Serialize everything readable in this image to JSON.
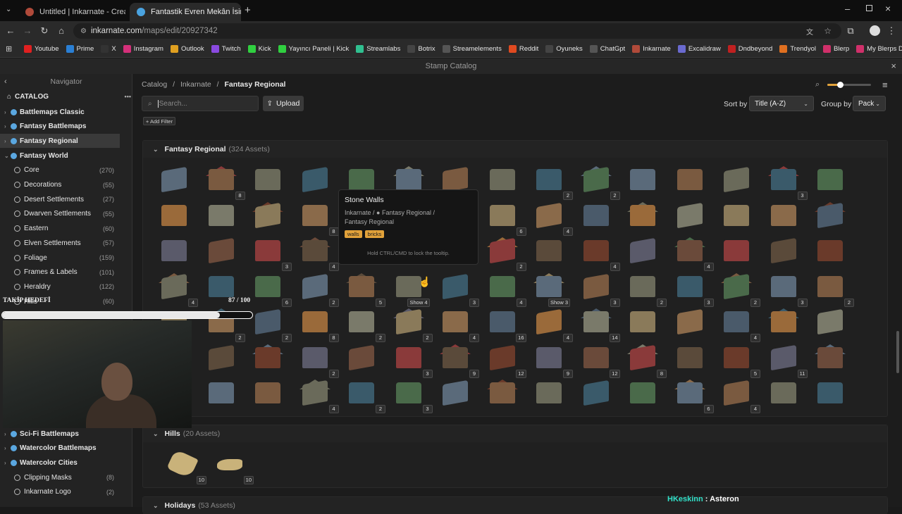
{
  "browser": {
    "tabs": [
      {
        "title": "Untitled | Inkarnate - Create Fa",
        "favicon_color": "#b04a3a"
      },
      {
        "title": "Fantastik Evren Mekân İsimleri",
        "favicon_color": "#4aa3e0"
      }
    ],
    "url_host": "inkarnate.com",
    "url_path": "/maps/edit/20927342",
    "bookmarks": [
      {
        "label": "Youtube",
        "color": "#e02020"
      },
      {
        "label": "Prime",
        "color": "#2a7fd4"
      },
      {
        "label": "X",
        "color": "#333333"
      },
      {
        "label": "Instagram",
        "color": "#d4307a"
      },
      {
        "label": "Outlook",
        "color": "#e0a020"
      },
      {
        "label": "Twitch",
        "color": "#8a4ae0"
      },
      {
        "label": "Kick",
        "color": "#30d040"
      },
      {
        "label": "Yayıncı Paneli | Kick",
        "color": "#30d040"
      },
      {
        "label": "Streamlabs",
        "color": "#30c090"
      },
      {
        "label": "Botrix",
        "color": "#444444"
      },
      {
        "label": "Streamelements",
        "color": "#555555"
      },
      {
        "label": "Reddit",
        "color": "#e04a20"
      },
      {
        "label": "Oyuneks",
        "color": "#444444"
      },
      {
        "label": "ChatGpt",
        "color": "#555555"
      },
      {
        "label": "Inkarnate",
        "color": "#b04a3a"
      },
      {
        "label": "Excalidraw",
        "color": "#6a6ad0"
      },
      {
        "label": "Dndbeyond",
        "color": "#c02020"
      },
      {
        "label": "Trendyol",
        "color": "#e07020"
      },
      {
        "label": "Blerp",
        "color": "#d0306a"
      },
      {
        "label": "My Blerps Dashboard",
        "color": "#d0306a"
      }
    ]
  },
  "app": {
    "title": "Stamp Catalog"
  },
  "navigator": {
    "title": "Navigator",
    "catalog_label": "CATALOG",
    "more": "•••",
    "items": [
      {
        "label": "Battlemaps Classic",
        "type": "pack"
      },
      {
        "label": "Fantasy Battlemaps",
        "type": "pack"
      },
      {
        "label": "Fantasy Regional",
        "type": "pack",
        "selected": true
      },
      {
        "label": "Fantasy World",
        "type": "pack",
        "expanded": true
      },
      {
        "label": "Core",
        "count": "(270)",
        "type": "sub"
      },
      {
        "label": "Decorations",
        "count": "(55)",
        "type": "sub"
      },
      {
        "label": "Desert Settlements",
        "count": "(27)",
        "type": "sub"
      },
      {
        "label": "Dwarven Settlements",
        "count": "(55)",
        "type": "sub"
      },
      {
        "label": "Eastern",
        "count": "(60)",
        "type": "sub"
      },
      {
        "label": "Elven Settlements",
        "count": "(57)",
        "type": "sub"
      },
      {
        "label": "Foliage",
        "count": "(159)",
        "type": "sub"
      },
      {
        "label": "Frames & Labels",
        "count": "(101)",
        "type": "sub"
      },
      {
        "label": "Heraldry",
        "count": "(122)",
        "type": "sub"
      },
      {
        "label": "Hills",
        "count": "(60)",
        "type": "sub"
      }
    ],
    "bottom_items": [
      {
        "label": "Sci-Fi Battlemaps",
        "type": "pack"
      },
      {
        "label": "Watercolor Battlemaps",
        "type": "pack"
      },
      {
        "label": "Watercolor Cities",
        "type": "pack"
      },
      {
        "label": "Clipping Masks",
        "count": "(8)",
        "type": "sub"
      },
      {
        "label": "Inkarnate Logo",
        "count": "(2)",
        "type": "sub"
      }
    ]
  },
  "main": {
    "breadcrumb": [
      "Catalog",
      "Inkarnate",
      "Fantasy Regional"
    ],
    "search_placeholder": "Search...",
    "upload_label": "Upload",
    "add_filter": "+ Add Filter",
    "sort_label": "Sort by",
    "sort_value": "Title (A-Z)",
    "group_label": "Group by",
    "group_value": "Pack",
    "groups": [
      {
        "name": "Fantasy Regional",
        "count": "(324 Assets)"
      },
      {
        "name": "Hills",
        "count": "(20 Assets)"
      },
      {
        "name": "Holidays",
        "count": "(53 Assets)"
      }
    ],
    "badges_row1": [
      "",
      "8",
      "",
      "",
      "",
      "",
      "",
      "",
      "2",
      "2",
      "",
      "",
      "",
      "3",
      ""
    ],
    "badges_row2": [
      "",
      "",
      "",
      "8",
      "",
      "",
      "",
      "6",
      "4",
      "",
      "",
      "",
      "",
      "",
      ""
    ],
    "badges_row3": [
      "",
      "",
      "3",
      "4",
      "",
      "",
      "",
      "2",
      "",
      "4",
      "",
      "4",
      "",
      "",
      ""
    ],
    "badges_row4": [
      "4",
      "",
      "6",
      "2",
      "5",
      "Show 4",
      "3",
      "4",
      "Show 3",
      "3",
      "2",
      "3",
      "2",
      "3",
      "2"
    ],
    "badges_row5": [
      "",
      "2",
      "2",
      "8",
      "2",
      "2",
      "4",
      "16",
      "4",
      "14",
      "",
      "",
      "4",
      "",
      ""
    ],
    "badges_row6": [
      "",
      "",
      "",
      "2",
      "",
      "3",
      "9",
      "12",
      "9",
      "12",
      "8",
      "",
      "5",
      "11",
      ""
    ],
    "badges_row7": [
      "",
      "",
      "",
      "4",
      "2",
      "3",
      "",
      "",
      "",
      "",
      "",
      "6",
      "4",
      "",
      ""
    ],
    "hills_badges": [
      "10",
      "10"
    ]
  },
  "tooltip": {
    "title": "Stone Walls",
    "path1": "Inkarnate / ● Fantasy Regional /",
    "path2": "Fantasy Regional",
    "tags": [
      "walls",
      "bricks"
    ],
    "hint": "Hold CTRL/CMD to lock the tooltip."
  },
  "overlay": {
    "goal_label": "TAKİP HEDEFİ",
    "goal_count": "87 / 100",
    "goal_progress": 0.87,
    "chat_user": "HKeskinn",
    "chat_message": " : Asteron"
  }
}
